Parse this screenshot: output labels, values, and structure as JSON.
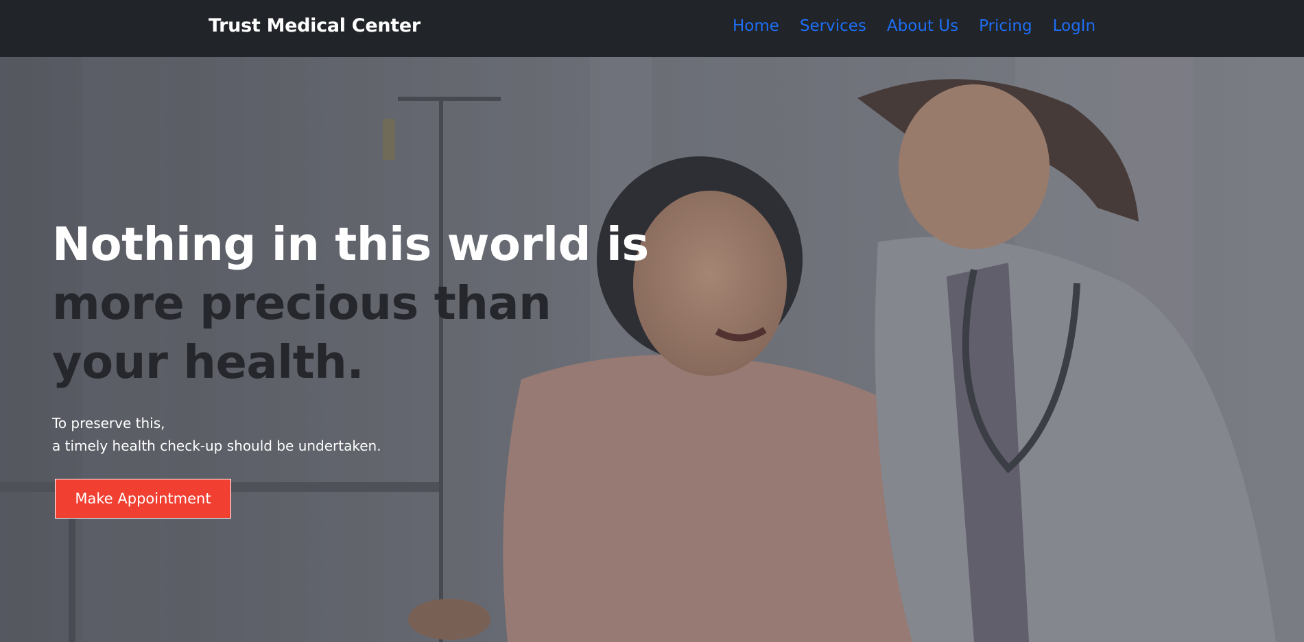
{
  "navbar": {
    "brand": "Trust Medical Center",
    "links": [
      "Home",
      "Services",
      "About Us",
      "Pricing",
      "LogIn"
    ]
  },
  "hero": {
    "headline_line1": "Nothing in this world is",
    "headline_line2": "more precious than",
    "headline_line3": "your health.",
    "subtext_line1": "To preserve this,",
    "subtext_line2": "a timely health check-up should be undertaken.",
    "cta_label": "Make Appointment",
    "image_description_icon": "hero-photo"
  },
  "colors": {
    "navbar_bg": "#212529",
    "brand_text": "#ffffff",
    "nav_link": "#1e6ef5",
    "headline_light": "#ffffff",
    "headline_dark": "#25272c",
    "cta_bg": "#f13f32"
  }
}
